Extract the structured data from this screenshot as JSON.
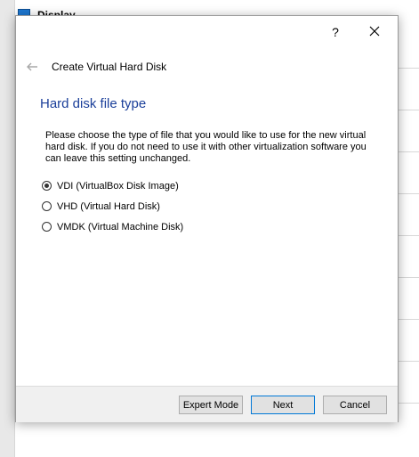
{
  "background": {
    "window_label": "Display"
  },
  "dialog": {
    "help_label": "?",
    "header_title": "Create Virtual Hard Disk",
    "section_title": "Hard disk file type",
    "description": "Please choose the type of file that you would like to use for the new virtual hard disk. If you do not need to use it with other virtualization software you can leave this setting unchanged.",
    "options": [
      {
        "label": "VDI (VirtualBox Disk Image)",
        "checked": true
      },
      {
        "label": "VHD (Virtual Hard Disk)",
        "checked": false
      },
      {
        "label": "VMDK (Virtual Machine Disk)",
        "checked": false
      }
    ],
    "buttons": {
      "expert_mode": "Expert Mode",
      "next": "Next",
      "cancel": "Cancel"
    }
  },
  "colors": {
    "section_title": "#1b3f9a",
    "default_button_border": "#0078d7"
  },
  "icons": {
    "back": "back-arrow-icon",
    "close": "close-icon",
    "display": "display-icon"
  }
}
